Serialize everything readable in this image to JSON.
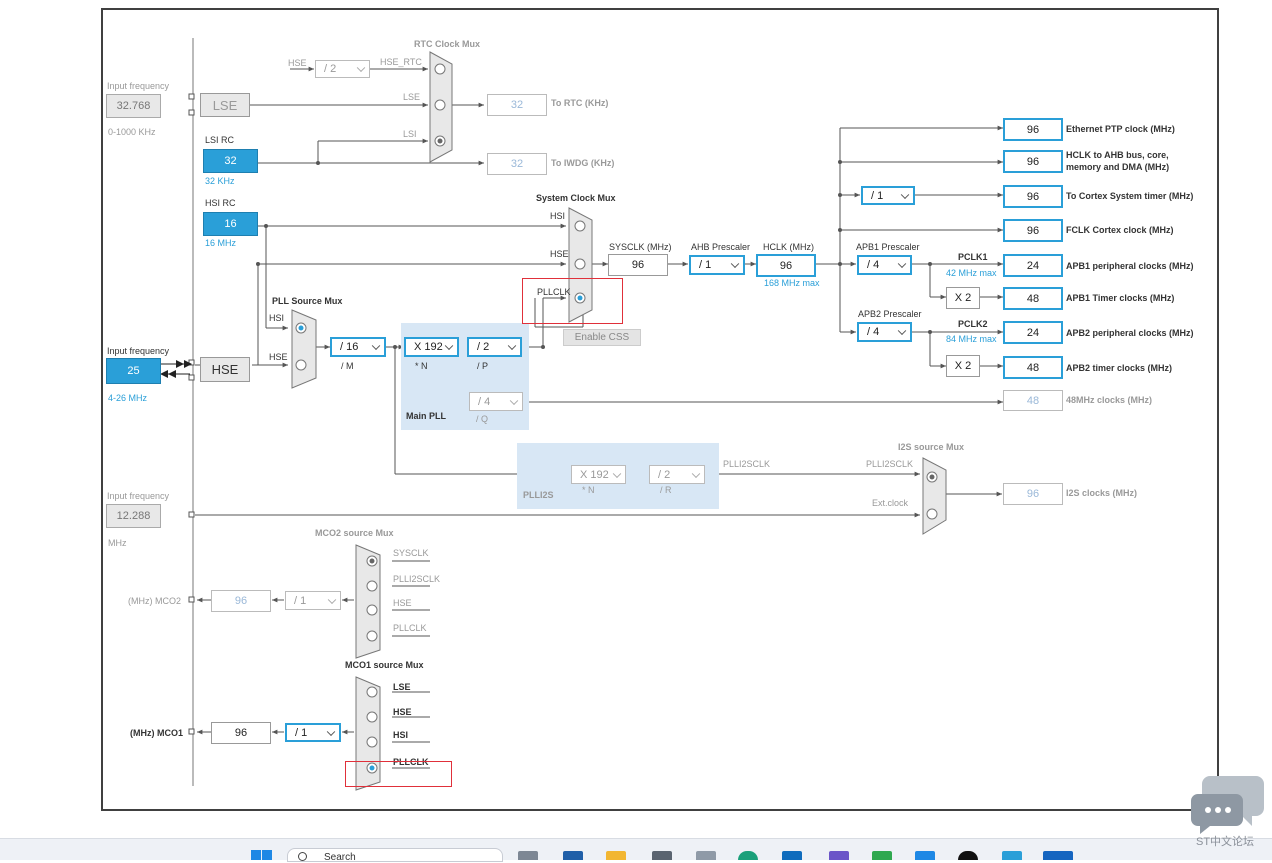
{
  "rtc_mux": {
    "title": "RTC Clock Mux",
    "hse_label": "HSE",
    "div": "/ 2",
    "hse_rtc": "HSE_RTC",
    "lse": "LSE",
    "lsi": "LSI",
    "out_value": "32",
    "out_label": "To RTC (KHz)"
  },
  "iwdg": {
    "value": "32",
    "label": "To IWDG (KHz)"
  },
  "input_freq_lse": {
    "title": "Input frequency",
    "value": "32.768",
    "range": "0-1000 KHz",
    "source": "LSE"
  },
  "lsi_rc": {
    "title": "LSI RC",
    "value": "32",
    "unit": "32 KHz"
  },
  "hsi_rc": {
    "title": "HSI RC",
    "value": "16",
    "unit": "16 MHz"
  },
  "input_freq_hse": {
    "title": "Input frequency",
    "value": "25",
    "range": "4-26 MHz",
    "source": "HSE"
  },
  "input_freq_ext": {
    "title": "Input frequency",
    "value": "12.288",
    "unit": "MHz"
  },
  "pll_source_mux": {
    "title": "PLL Source Mux",
    "hsi": "HSI",
    "hse": "HSE"
  },
  "main_pll": {
    "title": "Main PLL",
    "m_value": "/ 16",
    "m_label": "/ M",
    "n_value": "X 192",
    "n_label": "* N",
    "p_value": "/ 2",
    "p_label": "/ P",
    "q_value": "/ 4",
    "q_label": "/ Q"
  },
  "system_clock_mux": {
    "title": "System Clock Mux",
    "hsi": "HSI",
    "hse": "HSE",
    "pllclk": "PLLCLK",
    "css": "Enable CSS"
  },
  "sysclk": {
    "label": "SYSCLK (MHz)",
    "value": "96"
  },
  "ahb": {
    "label": "AHB Prescaler",
    "value": "/ 1"
  },
  "hclk": {
    "label": "HCLK (MHz)",
    "value": "96",
    "max": "168 MHz max"
  },
  "apb1": {
    "label": "APB1 Prescaler",
    "value": "/ 4",
    "pclk": "PCLK1",
    "max": "42 MHz max",
    "x2": "X 2"
  },
  "apb2": {
    "label": "APB2 Prescaler",
    "value": "/ 4",
    "pclk": "PCLK2",
    "max": "84 MHz max",
    "x2": "X 2"
  },
  "cortex_div": {
    "value": "/ 1"
  },
  "outputs": {
    "eth": {
      "value": "96",
      "label": "Ethernet PTP clock (MHz)"
    },
    "hclk_ahb": {
      "value": "96",
      "label1": "HCLK to AHB bus, core,",
      "label2": "memory and DMA (MHz)"
    },
    "cortex_timer": {
      "value": "96",
      "label": "To Cortex System timer (MHz)"
    },
    "fclk": {
      "value": "96",
      "label": "FCLK Cortex clock (MHz)"
    },
    "apb1_periph": {
      "value": "24",
      "label": "APB1 peripheral clocks (MHz)"
    },
    "apb1_timer": {
      "value": "48",
      "label": "APB1 Timer clocks (MHz)"
    },
    "apb2_periph": {
      "value": "24",
      "label": "APB2 peripheral clocks (MHz)"
    },
    "apb2_timer": {
      "value": "48",
      "label": "APB2 timer clocks (MHz)"
    },
    "usb48": {
      "value": "48",
      "label": "48MHz clocks (MHz)"
    },
    "i2s": {
      "value": "96",
      "label": "I2S clocks (MHz)"
    }
  },
  "plli2s": {
    "title": "PLLI2S",
    "n_value": "X 192",
    "n_label": "* N",
    "r_value": "/ 2",
    "r_label": "/ R",
    "out": "PLLI2SCLK"
  },
  "i2s_mux": {
    "title": "I2S source Mux",
    "plli2sclk": "PLLI2SCLK",
    "ext": "Ext.clock"
  },
  "mco2": {
    "title": "MCO2 source Mux",
    "opts": [
      "SYSCLK",
      "PLLI2SCLK",
      "HSE",
      "PLLCLK"
    ],
    "div": "/ 1",
    "value": "96",
    "out": "(MHz) MCO2"
  },
  "mco1": {
    "title": "MCO1 source Mux",
    "opts": [
      "LSE",
      "HSE",
      "HSI",
      "PLLCLK"
    ],
    "div": "/ 1",
    "value": "96",
    "out": "(MHz) MCO1"
  },
  "taskbar": {
    "search": "Search",
    "watermark": "ST中文论坛"
  },
  "colors": {
    "accent": "#2a9fd8",
    "highlight": "#e0303a",
    "panel": "#d8e7f5"
  }
}
